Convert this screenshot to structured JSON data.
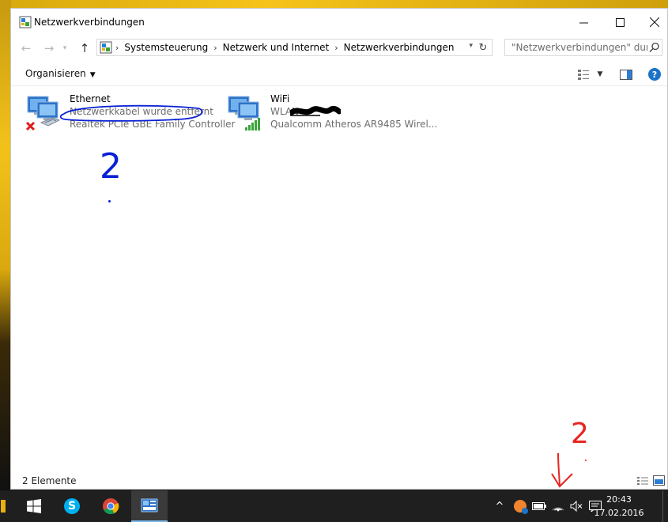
{
  "window": {
    "title": "Netzwerkverbindungen"
  },
  "address": {
    "breadcrumbs": [
      "Systemsteuerung",
      "Netzwerk und Internet",
      "Netzwerkverbindungen"
    ],
    "search_placeholder": "\"Netzwerkverbindungen\" dur..."
  },
  "toolbar": {
    "organize_label": "Organisieren"
  },
  "items": [
    {
      "name": "Ethernet",
      "status": "Netzwerkkabel wurde entfernt",
      "device": "Realtek PCIe GBE Family Controller"
    },
    {
      "name": "WiFi",
      "status": "WLAN",
      "device": "Qualcomm Atheros AR9485 Wirel..."
    }
  ],
  "statusbar": {
    "count": "2 Elemente"
  },
  "annotations": {
    "mark_upper": "2",
    "mark_tray": "2"
  },
  "taskbar": {
    "time": "20:43",
    "date": "17.02.2016"
  },
  "colors": {
    "accent": "#1a73c9",
    "annotation_blue": "#0a21d6",
    "annotation_red": "#e8241f",
    "taskbar": "#1f1f1f"
  }
}
